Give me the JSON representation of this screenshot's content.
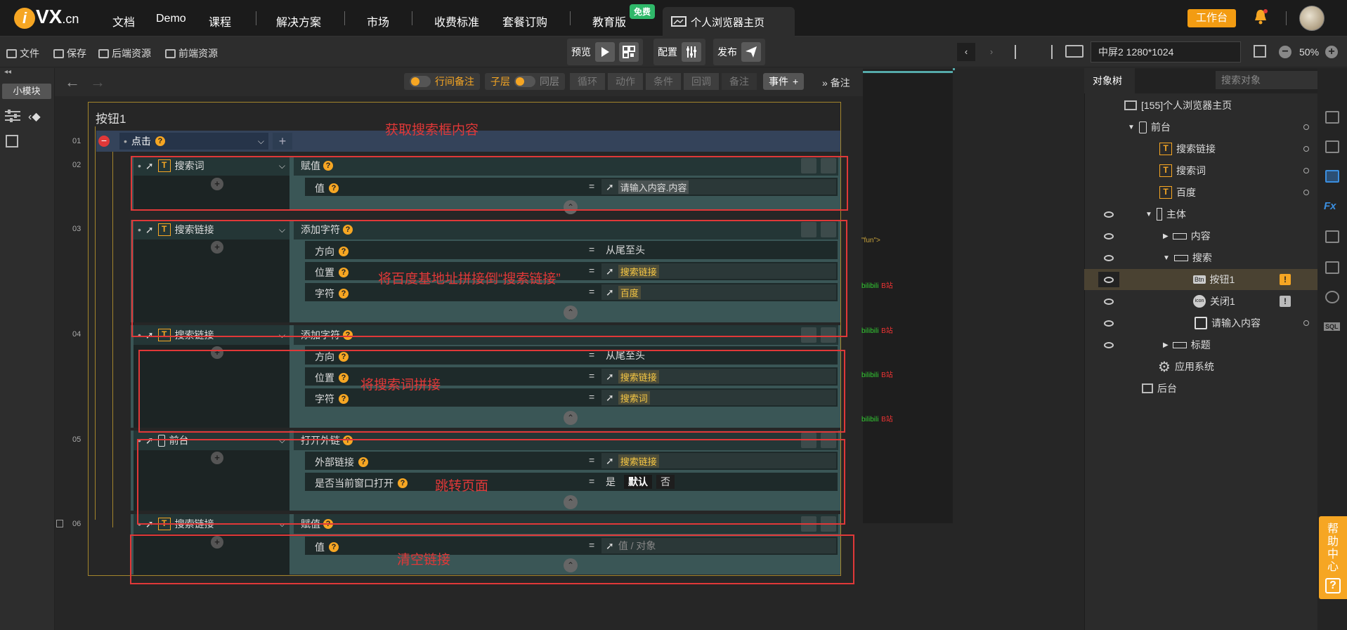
{
  "nav": {
    "logo_text": "VX",
    "logo_suffix": ".cn",
    "items": [
      "文档",
      "Demo",
      "课程",
      "解决方案",
      "市场",
      "收费标准",
      "套餐订购",
      "教育版"
    ],
    "free_badge": "免费",
    "page_tab": "个人浏览器主页",
    "workbench": "工作台"
  },
  "toolbar": {
    "file": "文件",
    "save": "保存",
    "backend": "后端资源",
    "frontend": "前端资源",
    "preview": "预览",
    "config": "配置",
    "publish": "发布",
    "screen": "中屏2 1280*1024",
    "zoom": "50%"
  },
  "left": {
    "module": "小模块"
  },
  "editor": {
    "row_note": "行间备注",
    "child_layer": "子层",
    "same_layer": "同层",
    "tabs": [
      "循环",
      "动作",
      "条件",
      "回调",
      "备注"
    ],
    "event_btn": "事件",
    "note_btn": "备注"
  },
  "panel": {
    "title": "按钮1",
    "trigger": "点击",
    "row_numbers": [
      "01",
      "02",
      "03",
      "04",
      "05",
      "06"
    ],
    "actions": [
      {
        "target": "搜索词",
        "op": "赋值",
        "params": [
          {
            "label": "值",
            "value": "请输入内容.内容"
          }
        ]
      },
      {
        "target": "搜索链接",
        "op": "添加字符",
        "params": [
          {
            "label": "方向",
            "value": "从尾至头"
          },
          {
            "label": "位置",
            "value": "搜索链接"
          },
          {
            "label": "字符",
            "value": "百度"
          }
        ]
      },
      {
        "target": "搜索链接",
        "op": "添加字符",
        "params": [
          {
            "label": "方向",
            "value": "从尾至头"
          },
          {
            "label": "位置",
            "value": "搜索链接"
          },
          {
            "label": "字符",
            "value": "搜索词"
          }
        ]
      },
      {
        "target": "前台",
        "op": "打开外链",
        "params": [
          {
            "label": "外部链接",
            "value": "搜索链接"
          },
          {
            "label": "是否当前窗口打开",
            "options": [
              "是",
              "默认",
              "否"
            ]
          }
        ]
      },
      {
        "target": "搜索链接",
        "op": "赋值",
        "params": [
          {
            "label": "值",
            "placeholder": "值 / 对象"
          }
        ]
      }
    ]
  },
  "annotations": [
    "获取搜索框内容",
    "将百度基地址拼接倒“搜索链接”",
    "将搜索词拼接",
    "跳转页面",
    "清空链接"
  ],
  "side_code": {
    "fun": "\"fun\">",
    "bili": "bilibili",
    "b": "B站"
  },
  "tree": {
    "tab": "对象树",
    "search_placeholder": "搜索对象",
    "nodes": [
      "[155]个人浏览器主页",
      "前台",
      "搜索链接",
      "搜索词",
      "百度",
      "主体",
      "内容",
      "搜索",
      "按钮1",
      "关闭1",
      "请输入内容",
      "标题",
      "应用系统",
      "后台"
    ]
  },
  "help": "帮助中心",
  "colors": {
    "accent": "#f6a623",
    "annotation": "#e03838",
    "selected": "#4a4232"
  }
}
